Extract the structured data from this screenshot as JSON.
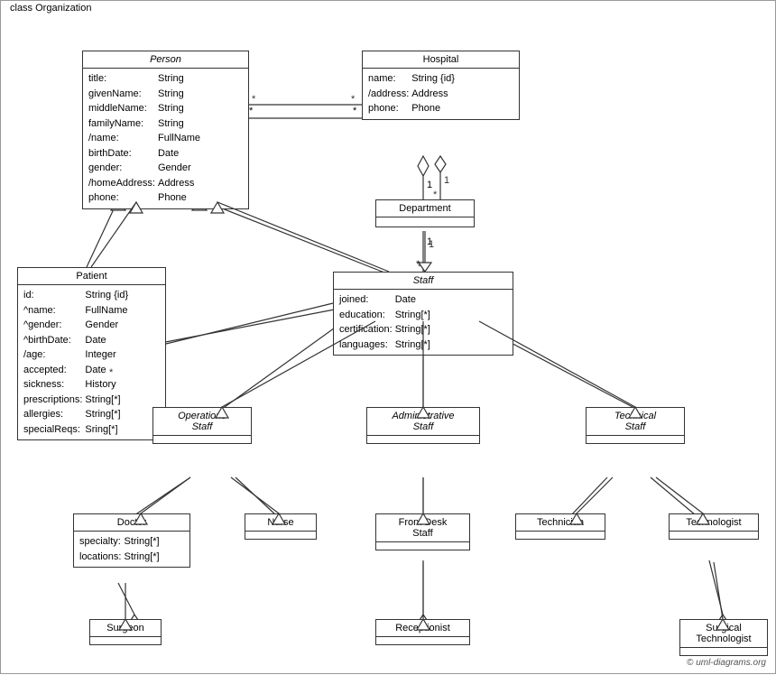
{
  "diagram_title": "class Organization",
  "classes": {
    "person": {
      "name": "Person",
      "italic": true,
      "attributes": [
        [
          "title:",
          "String"
        ],
        [
          "givenName:",
          "String"
        ],
        [
          "middleName:",
          "String"
        ],
        [
          "familyName:",
          "String"
        ],
        [
          "/name:",
          "FullName"
        ],
        [
          "birthDate:",
          "Date"
        ],
        [
          "gender:",
          "Gender"
        ],
        [
          "/homeAddress:",
          "Address"
        ],
        [
          "phone:",
          "Phone"
        ]
      ]
    },
    "hospital": {
      "name": "Hospital",
      "italic": false,
      "attributes": [
        [
          "name:",
          "String {id}"
        ],
        [
          "/address:",
          "Address"
        ],
        [
          "phone:",
          "Phone"
        ]
      ]
    },
    "department": {
      "name": "Department",
      "italic": false,
      "attributes": []
    },
    "patient": {
      "name": "Patient",
      "italic": false,
      "attributes": [
        [
          "id:",
          "String {id}"
        ],
        [
          "^name:",
          "FullName"
        ],
        [
          "^gender:",
          "Gender"
        ],
        [
          "^birthDate:",
          "Date"
        ],
        [
          "/age:",
          "Integer"
        ],
        [
          "accepted:",
          "Date"
        ],
        [
          "sickness:",
          "History"
        ],
        [
          "prescriptions:",
          "String[*]"
        ],
        [
          "allergies:",
          "String[*]"
        ],
        [
          "specialReqs:",
          "Sring[*]"
        ]
      ]
    },
    "staff": {
      "name": "Staff",
      "italic": true,
      "attributes": [
        [
          "joined:",
          "Date"
        ],
        [
          "education:",
          "String[*]"
        ],
        [
          "certification:",
          "String[*]"
        ],
        [
          "languages:",
          "String[*]"
        ]
      ]
    },
    "operations_staff": {
      "name": "Operations\nStaff",
      "italic": true,
      "attributes": []
    },
    "administrative_staff": {
      "name": "Administrative\nStaff",
      "italic": true,
      "attributes": []
    },
    "technical_staff": {
      "name": "Technical\nStaff",
      "italic": true,
      "attributes": []
    },
    "doctor": {
      "name": "Doctor",
      "italic": false,
      "attributes": [
        [
          "specialty:",
          "String[*]"
        ],
        [
          "locations:",
          "String[*]"
        ]
      ]
    },
    "nurse": {
      "name": "Nurse",
      "italic": false,
      "attributes": []
    },
    "front_desk_staff": {
      "name": "Front Desk\nStaff",
      "italic": false,
      "attributes": []
    },
    "technician": {
      "name": "Technician",
      "italic": false,
      "attributes": []
    },
    "technologist": {
      "name": "Technologist",
      "italic": false,
      "attributes": []
    },
    "surgeon": {
      "name": "Surgeon",
      "italic": false,
      "attributes": []
    },
    "receptionist": {
      "name": "Receptionist",
      "italic": false,
      "attributes": []
    },
    "surgical_technologist": {
      "name": "Surgical\nTechnologist",
      "italic": false,
      "attributes": []
    }
  },
  "copyright": "© uml-diagrams.org"
}
